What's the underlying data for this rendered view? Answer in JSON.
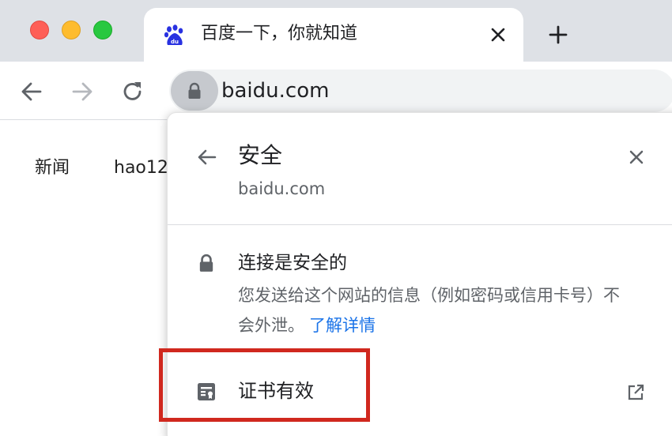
{
  "browser": {
    "tab": {
      "title": "百度一下，你就知道",
      "favicon": "baidu-paw-icon"
    },
    "toolbar": {
      "url": "baidu.com",
      "site_info_icon": "lock-icon"
    }
  },
  "page": {
    "nav_links": [
      "新闻",
      "hao12"
    ]
  },
  "site_info_popup": {
    "title": "安全",
    "domain": "baidu.com",
    "connection": {
      "title": "连接是安全的",
      "description": "您发送给这个网站的信息（例如密码或信用卡号）不会外泄。",
      "learn_more": "了解详情"
    },
    "certificate": {
      "label": "证书有效"
    }
  },
  "colors": {
    "tabstrip": "#dee1e6",
    "link": "#1a73e8",
    "highlight": "#d0281e",
    "baidu_blue": "#2932e1"
  }
}
